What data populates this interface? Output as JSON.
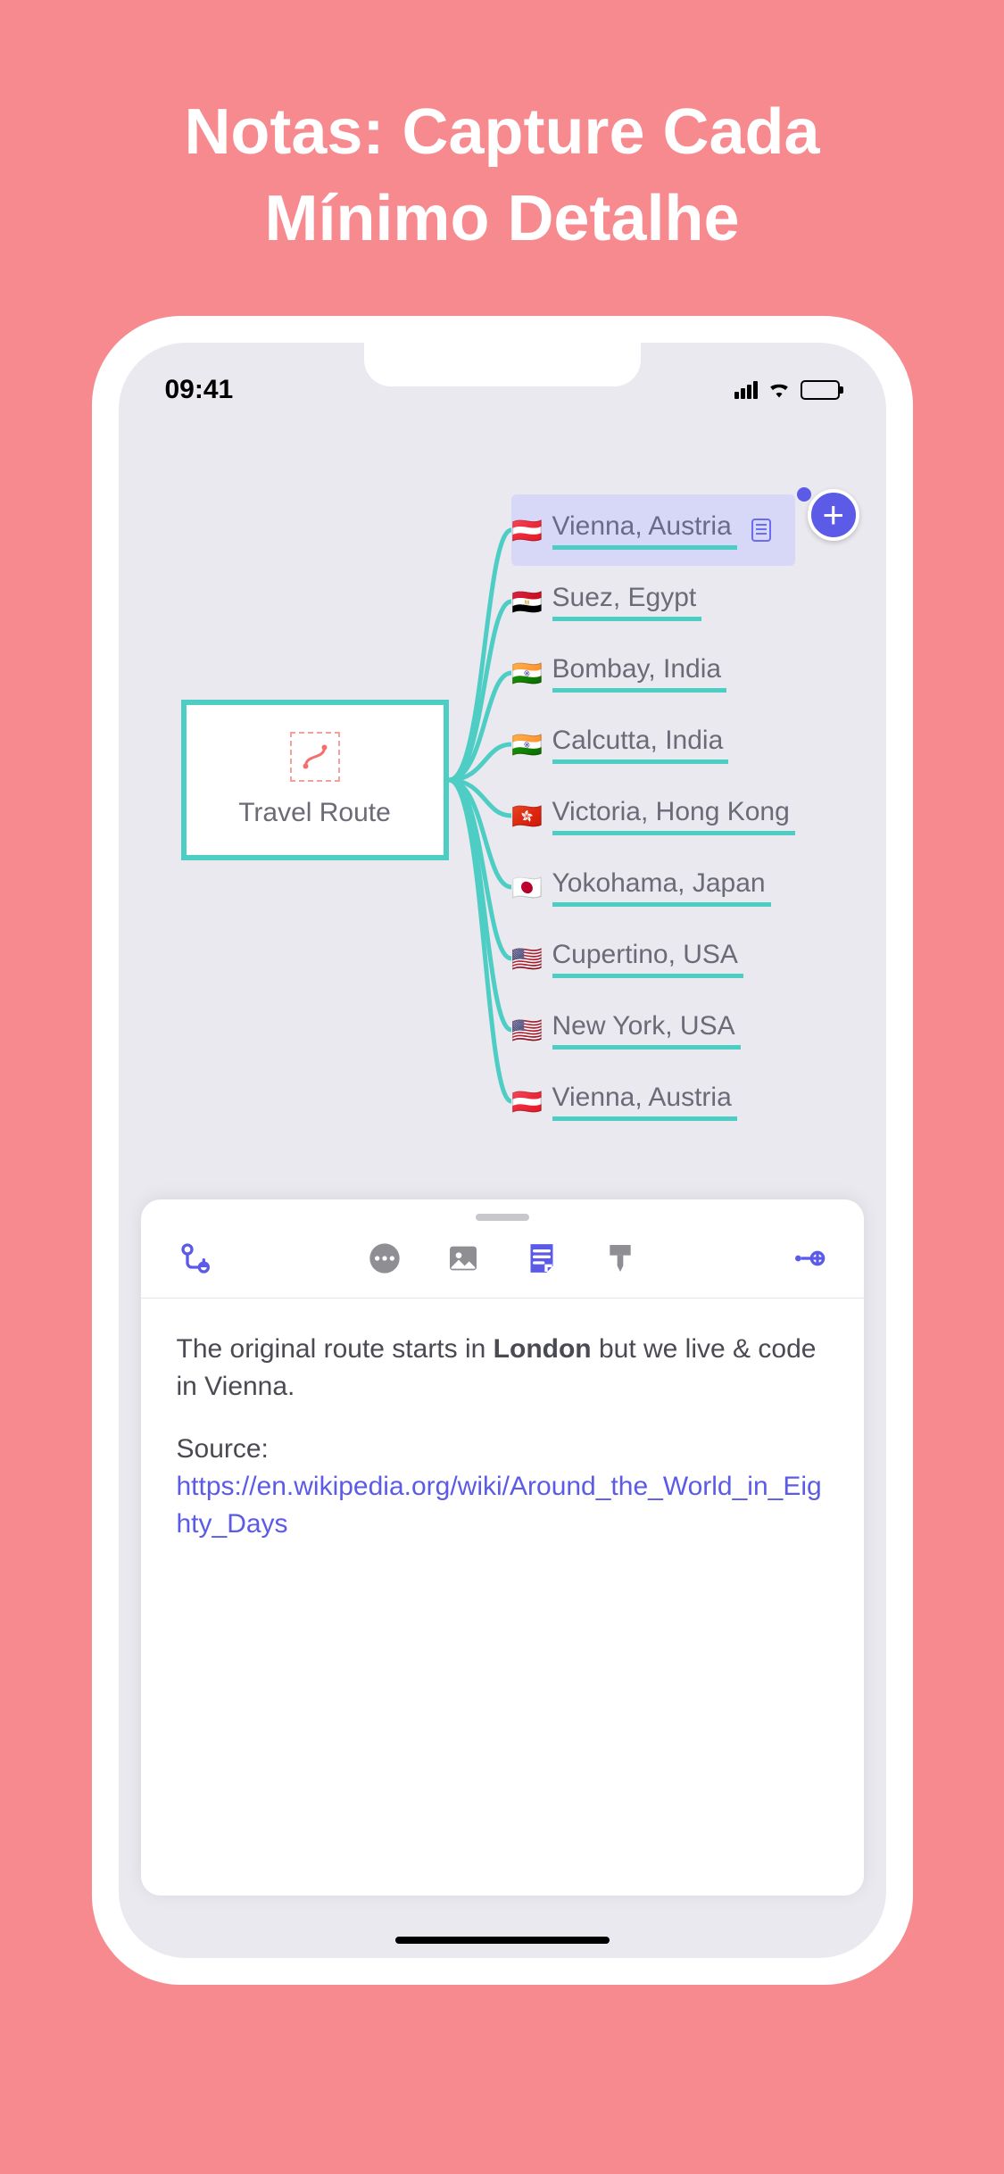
{
  "promo": {
    "title_line1": "Notas: Capture Cada",
    "title_line2": "Mínimo Detalhe"
  },
  "status_bar": {
    "time": "09:41"
  },
  "mindmap": {
    "root_label": "Travel Route",
    "root_icon_name": "route-icon",
    "add_button_glyph": "+",
    "children": [
      {
        "flag": "🇦🇹",
        "label": "Vienna, Austria",
        "selected": true,
        "has_note": true
      },
      {
        "flag": "🇪🇬",
        "label": "Suez, Egypt"
      },
      {
        "flag": "🇮🇳",
        "label": "Bombay, India"
      },
      {
        "flag": "🇮🇳",
        "label": "Calcutta, India"
      },
      {
        "flag": "🇭🇰",
        "label": "Victoria, Hong Kong"
      },
      {
        "flag": "🇯🇵",
        "label": "Yokohama, Japan"
      },
      {
        "flag": "🇺🇸",
        "label": "Cupertino, USA"
      },
      {
        "flag": "🇺🇸",
        "label": "New York, USA"
      },
      {
        "flag": "🇦🇹",
        "label": "Vienna, Austria"
      }
    ]
  },
  "note": {
    "text_before_bold": "The original route starts in ",
    "bold_word": "London",
    "text_after_bold": " but we live & code in Vienna.",
    "source_label": "Source: ",
    "source_url": "https://en.wikipedia.org/wiki/Around_the_World_in_Eighty_Days"
  },
  "toolbar_icons": {
    "add_child": "add-child-icon",
    "more": "more-icon",
    "image": "image-icon",
    "note": "note-icon",
    "style": "style-brush-icon",
    "link": "link-node-icon"
  }
}
